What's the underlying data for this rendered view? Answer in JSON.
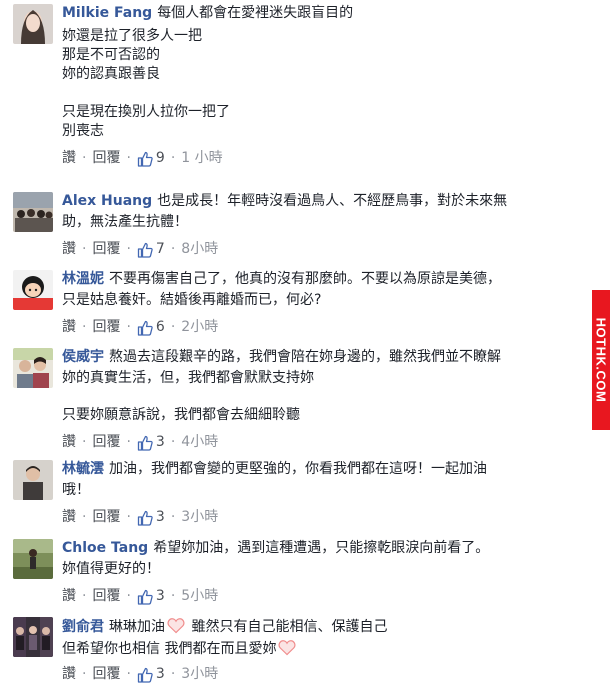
{
  "comments": [
    {
      "name": "Milkie Fang",
      "lines": [
        "每個人都會在愛裡迷失跟盲目的",
        "妳還是拉了很多人一把",
        "那是不可否認的",
        "妳的認真跟善良",
        "",
        "只是現在換別人拉你一把了",
        "別喪志"
      ],
      "like_label": "讚",
      "reply_label": "回覆",
      "likes": "9",
      "time": "1 小時"
    },
    {
      "name": "Alex Huang",
      "lines": [
        "也是成長！年輕時沒看過鳥人、不經歷鳥事，對於未來無",
        "助，無法產生抗體！"
      ],
      "like_label": "讚",
      "reply_label": "回覆",
      "likes": "7",
      "time": "8小時"
    },
    {
      "name": "林溫妮",
      "lines": [
        "不要再傷害自己了，他真的沒有那麼帥。不要以為原諒是美德，",
        "只是姑息養奸。結婚後再離婚而已，何必?"
      ],
      "like_label": "讚",
      "reply_label": "回覆",
      "likes": "6",
      "time": "2小時"
    },
    {
      "name": "侯威宇",
      "lines": [
        "熬過去這段艱辛的路，我們會陪在妳身邊的，雖然我們並不瞭解",
        "妳的真實生活，但，我們都會默默支持妳",
        "",
        "只要妳願意訴說，我們都會去細細聆聽"
      ],
      "like_label": "讚",
      "reply_label": "回覆",
      "likes": "3",
      "time": "4小時"
    },
    {
      "name": "林毓澐",
      "lines": [
        "加油，我們都會變的更堅強的，你看我們都在這呀！一起加油",
        "哦！"
      ],
      "like_label": "讚",
      "reply_label": "回覆",
      "likes": "3",
      "time": "3小時"
    },
    {
      "name": "Chloe Tang",
      "lines": [
        "希望妳加油，遇到這種遭遇，只能擦乾眼淚向前看了。",
        "妳值得更好的！"
      ],
      "like_label": "讚",
      "reply_label": "回覆",
      "likes": "3",
      "time": "5小時"
    },
    {
      "name": "劉俞君",
      "line1_a": "琳琳加油",
      "line1_b": " 雖然只有自己能相信、保護自己",
      "line2_a": "但希望你也相信 我們都在而且愛妳",
      "like_label": "讚",
      "reply_label": "回覆",
      "likes": "3",
      "time": "3小時"
    }
  ],
  "watermark": "HOTHK.COM",
  "colors": {
    "name": "#365899",
    "meta": "#90949c",
    "like_blue": "#4267b2",
    "heart": "#f4a4a4",
    "watermark_bg": "#e8171f"
  },
  "icons": {
    "like": "thumbs-up-icon",
    "heart": "heart-emoji-icon"
  }
}
